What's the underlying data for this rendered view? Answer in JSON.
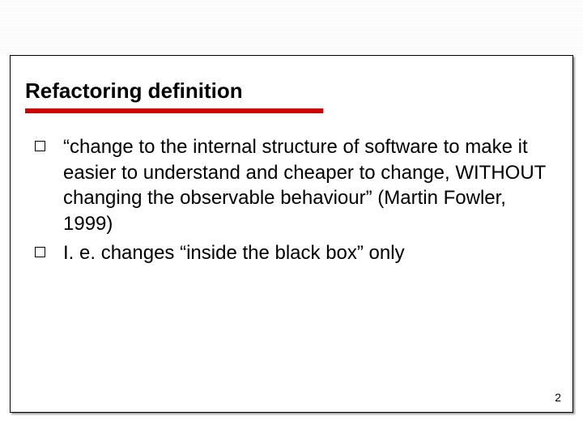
{
  "slide": {
    "title": "Refactoring definition",
    "bullets": [
      "“change to the internal structure of software to make it easier to understand and cheaper to change, WITHOUT changing the observable behaviour” (Martin Fowler, 1999)",
      "I. e. changes “inside the black box” only"
    ],
    "page_number": "2"
  }
}
